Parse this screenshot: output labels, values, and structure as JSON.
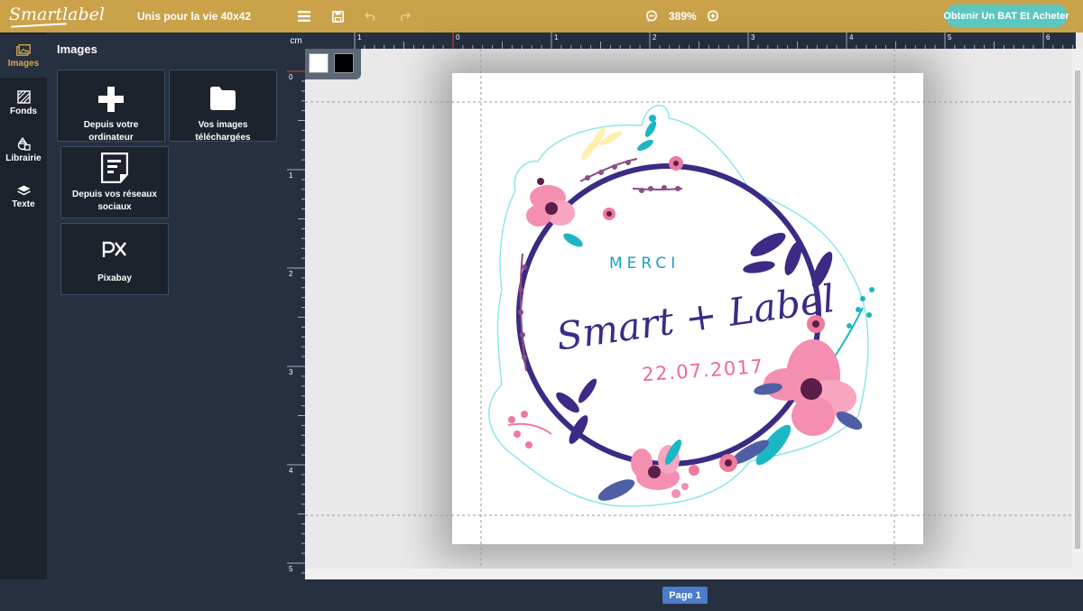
{
  "header": {
    "logo": "Smartlabel",
    "document_title": "Unis pour la vie 40x42",
    "zoom": "389%",
    "cta_label": "Obtenir Un BAT Et Acheter",
    "icons": [
      "menu-icon",
      "save-icon",
      "undo-icon",
      "redo-icon",
      "zoom-out-icon",
      "zoom-in-icon"
    ]
  },
  "sidebar": {
    "items": [
      {
        "label": "Images",
        "icon": "images-icon",
        "active": true
      },
      {
        "label": "Fonds",
        "icon": "backgrounds-icon"
      },
      {
        "label": "Librairie",
        "icon": "library-icon"
      },
      {
        "label": "Texte",
        "icon": "text-layers-icon"
      }
    ]
  },
  "panel": {
    "title": "Images",
    "tiles": [
      {
        "label": "Depuis votre ordinateur",
        "icon": "plus-icon"
      },
      {
        "label": "Vos images téléchargées",
        "icon": "folder-icon"
      },
      {
        "label": "Depuis vos réseaux sociaux",
        "icon": "social-document-icon"
      },
      {
        "label": "Pixabay",
        "icon": "pixabay-icon"
      }
    ]
  },
  "ruler": {
    "unit": "cm",
    "top_labels": [
      "1",
      "0",
      "1",
      "2",
      "3",
      "4",
      "5",
      "6"
    ],
    "left_labels": [
      "0",
      "1",
      "2",
      "3",
      "4",
      "5"
    ]
  },
  "swatches": {
    "colors": [
      "#ffffff",
      "#000000"
    ]
  },
  "design": {
    "top_word": "MERCI",
    "main_text": "Smart + Label",
    "date": "22.07.2017",
    "colors": {
      "wreath": "#3d2a85",
      "pink": "#ee7a9c",
      "teal": "#1bb7c4",
      "date": "#ee6a91"
    }
  },
  "footer": {
    "page_label": "Page 1"
  }
}
